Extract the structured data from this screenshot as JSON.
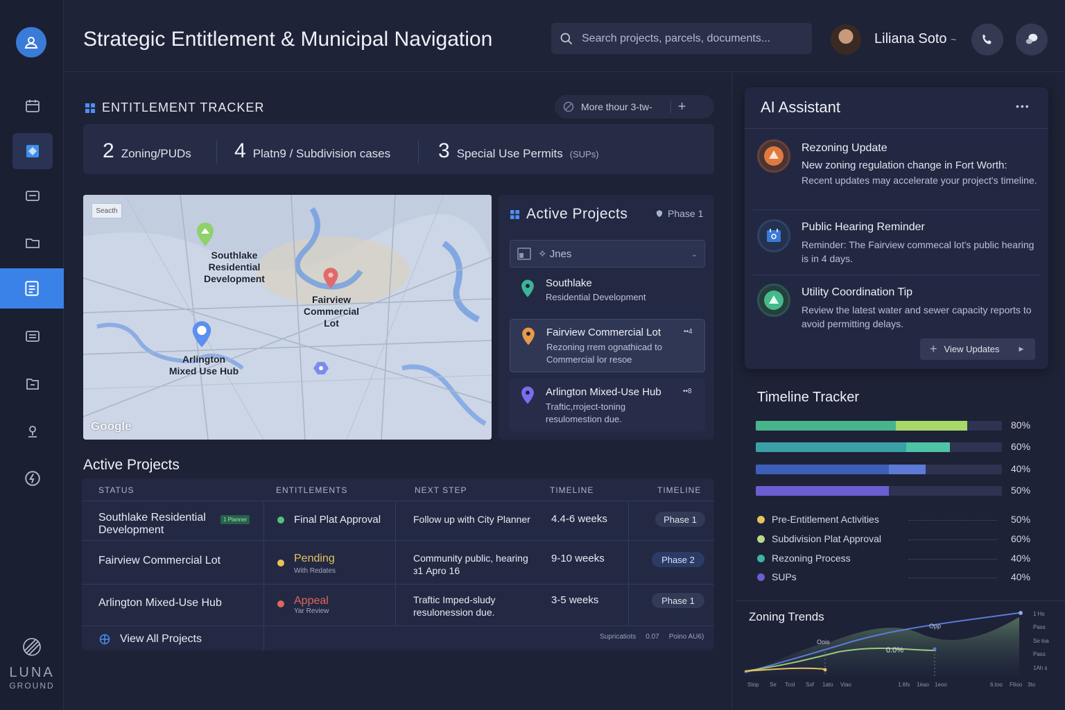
{
  "header": {
    "title": "Strategic Entitlement & Municipal Navigation",
    "search_placeholder": "Search projects, parcels, documents...",
    "user_name": "Liliana Soto",
    "user_caret": "~"
  },
  "brand": {
    "line1": "LUNA",
    "line2": "GROUND"
  },
  "tracker": {
    "title": "ENTITLEMENT TRACKER",
    "filter_label": "More thour 3-tw-",
    "stats": [
      {
        "n": "2",
        "label": "Zoning/PUDs",
        "sub": ""
      },
      {
        "n": "4",
        "label": "Platn9 / Subdivision cases",
        "sub": ""
      },
      {
        "n": "3",
        "label": "Special Use Permits",
        "sub": "(SUPs)"
      }
    ]
  },
  "map": {
    "search_label": "Seacth",
    "watermark": "Google",
    "pins": [
      {
        "label": "Southlake\nResidential\nDevelopment",
        "color": "#8fd16a"
      },
      {
        "label": "Fairview\nCommercial\nLot",
        "color": "#e06a6a"
      },
      {
        "label": "Arlington\nMixed Use Hub",
        "color": "#5b8ff0"
      }
    ]
  },
  "active_panel": {
    "title": "Active Projects",
    "phase": "Phase 1",
    "select_value": "Jnes",
    "cards": [
      {
        "title": "Southlake",
        "desc": "Residential Development",
        "pin_color": "#3bb49a",
        "badge": ""
      },
      {
        "title": "Fairview Commercial Lot",
        "desc": "Rezoning rrem ognathicad to Commercial lor resoe",
        "pin_color": "#e89a4a",
        "badge": "••4"
      },
      {
        "title": "Arlington Mixed-Use Hub",
        "desc": "Traftic,rroject-toning resulomestion due.",
        "pin_color": "#7b6cf0",
        "badge": "••8"
      }
    ]
  },
  "table": {
    "title": "Active Projects",
    "headers": [
      "STATUS",
      "ENTITLEMENTS",
      "NEXT STEP",
      "TIMELINE",
      "TIMELINE"
    ],
    "rows": [
      {
        "name": "Southlake Residential Development",
        "tag": "1 Planner",
        "ent": "Final Plat Approval",
        "ent_sub": "",
        "ent_color": "#4fc17f",
        "dot": "#4fc17f",
        "next": "Follow up with City Planner",
        "time": "4.4-6 weeks",
        "phase": "Phase 1",
        "phase_accent": false
      },
      {
        "name": "Fairview Commercial Lot",
        "tag": "",
        "ent": "Pending",
        "ent_sub": "With Redates",
        "ent_color": "#e8c25a",
        "dot": "#e8c25a",
        "next": "Community public, hearing з1 Apro 16",
        "time": "9-10 weeks",
        "phase": "Phase 2",
        "phase_accent": true
      },
      {
        "name": "Arlington Mixed-Use Hub",
        "tag": "",
        "ent": "Appeal",
        "ent_sub": "Yar Review",
        "ent_color": "#e0675c",
        "dot": "#e0675c",
        "next": "Traftic Imped-sludy resulonession due.",
        "time": "3-5 weeks",
        "phase": "Phase 1",
        "phase_accent": false
      }
    ],
    "footer_link": "View All Projects",
    "footer_meta": [
      "Supricatiots",
      "0.07",
      "Poino AU6)"
    ]
  },
  "ai": {
    "title": "AI Assistant",
    "menu": "•••",
    "items": [
      {
        "title": "Rezoning Update",
        "lead": "New zoning regulation change in Fort Worth:",
        "desc": "Recent updates may accelerate your project's timeline.",
        "icon_bg": "#e0793f",
        "icon_ring": "#5a3a33"
      },
      {
        "title": "Public Hearing Reminder",
        "lead": "",
        "desc": "Reminder: The Fairview commecal lot's public hearing is in 4 days.",
        "icon_bg": "#3b79d6",
        "icon_ring": "#2c3c5e"
      },
      {
        "title": "Utility Coordination Tip",
        "lead": "",
        "desc": "Review the latest water and sewer capacity reports to avoid permitting delays.",
        "icon_bg": "#46b98a",
        "icon_ring": "#2b4b48"
      }
    ],
    "button": "View Updates"
  },
  "timeline": {
    "title": "Timeline Tracker",
    "bars": [
      {
        "a": 0.57,
        "b": 0.86,
        "ca": "#46b58c",
        "cb": "#a8d86a",
        "pct": "80%"
      },
      {
        "a": 0.61,
        "b": 0.79,
        "ca": "#3aa0a6",
        "cb": "#4fc3a6",
        "pct": "60%"
      },
      {
        "a": 0.54,
        "b": 0.69,
        "ca": "#3e5fb8",
        "cb": "#5d7ad6",
        "pct": "40%"
      },
      {
        "a": 0.54,
        "b": 0.54,
        "ca": "#6a5ed0",
        "cb": "#6a5ed0",
        "pct": "50%"
      }
    ],
    "legend": [
      {
        "label": "Pre-Entitlement Activities",
        "color": "#e8c25a",
        "pct": "50%"
      },
      {
        "label": "Subdivision Plat Approval",
        "color": "#b9d98a",
        "pct": "60%"
      },
      {
        "label": "Rezoning Process",
        "color": "#3fb3a6",
        "pct": "40%"
      },
      {
        "label": "SUPs",
        "color": "#6a5ed0",
        "pct": "40%"
      }
    ]
  },
  "zoning": {
    "title": "Zoning Trends",
    "labels": {
      "oois": "Oois",
      "opp": "Opp",
      "mid": "0.0%"
    },
    "y_ticks": [
      "1 Hs",
      "Pass",
      "Se loa",
      "Pass",
      "1Ah s"
    ],
    "x_ticks": [
      "Stop",
      "Se",
      "Tcol",
      "Sof",
      "1ato",
      "Viao",
      "1.6fs",
      "1éao",
      "1eoo",
      "6.too",
      "F6oo",
      "3to"
    ]
  }
}
